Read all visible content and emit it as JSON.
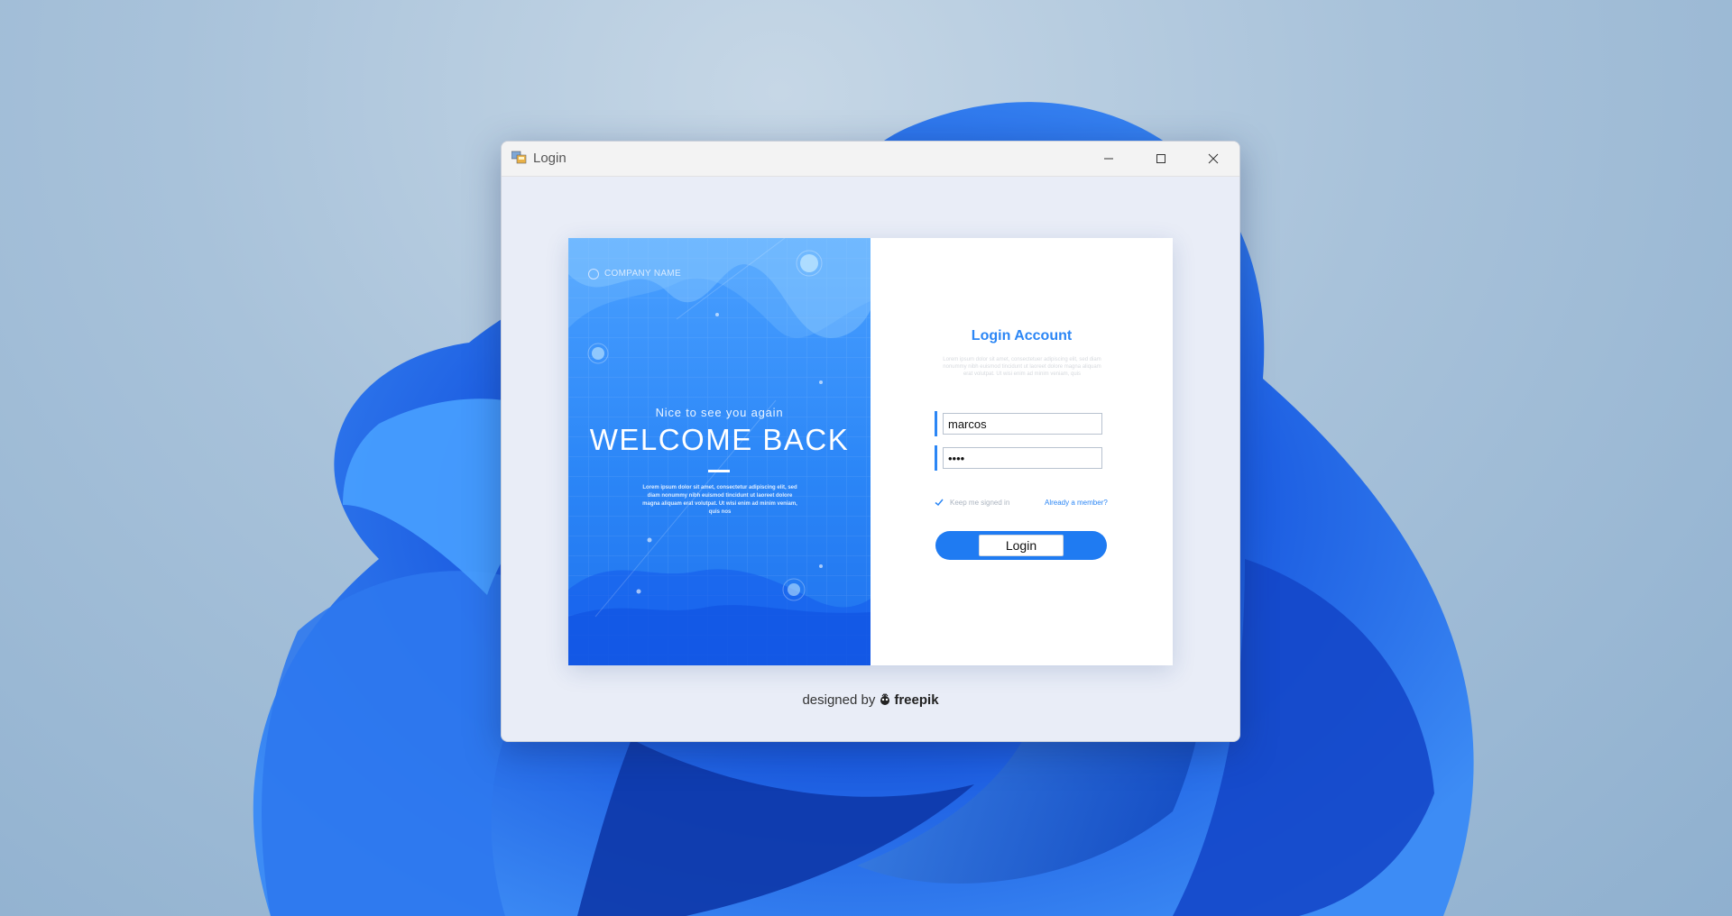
{
  "window": {
    "title": "Login",
    "controls": {
      "minimize": "minimize-icon",
      "maximize": "maximize-icon",
      "close": "close-icon"
    }
  },
  "left_panel": {
    "company_name": "COMPANY NAME",
    "greeting": "Nice to see you again",
    "headline": "WELCOME BACK",
    "body": "Lorem ipsum dolor sit amet, consectetur adipiscing elit, sed diam nonummy nibh euismod tincidunt ut laoreet dolore magna aliquam erat volutpat. Ut wisi enim ad minim veniam, quis nos"
  },
  "right_panel": {
    "title": "Login Account",
    "description": "Lorem ipsum dolor sit amet, consectetuer adipiscing elit, sed diam nonummy nibh euismod tincidunt ut laoreet dolore magna aliquam erat volutpat. Ut wisi enim ad minim veniam, quis",
    "username": {
      "value": "marcos"
    },
    "password": {
      "value": "••••"
    },
    "keep_signed_in": "Keep me signed in",
    "already_member": "Already a member?",
    "login_label": "Login"
  },
  "footer": {
    "designed_by": "designed by",
    "brand": "freepik"
  },
  "colors": {
    "accent": "#2b86f5",
    "button": "#1f7bf2",
    "panel_top": "#4aa0ff",
    "panel_bottom": "#1f72ee"
  }
}
